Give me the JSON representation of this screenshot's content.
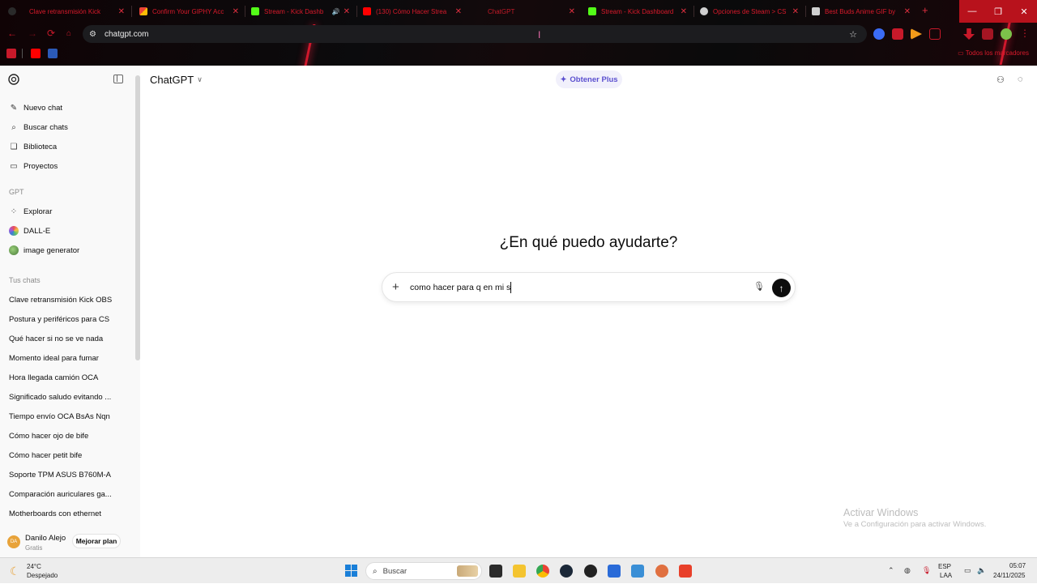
{
  "browser": {
    "tabs": [
      {
        "label": "Clave retransmisión Kick",
        "icon": "chatgpt-icon",
        "has_speaker": false
      },
      {
        "label": "Confirm Your GIPHY Acc",
        "icon": "gmail-icon",
        "has_speaker": false
      },
      {
        "label": "Stream - Kick Dashboard",
        "icon": "kick-icon",
        "has_speaker": false
      },
      {
        "label": "Stream - Kick Dashb",
        "icon": "kick-icon",
        "has_speaker": true
      },
      {
        "label": "(130) Cómo Hacer Strea",
        "icon": "youtube-icon",
        "has_speaker": false
      },
      {
        "label": "ChatGPT",
        "icon": "chatgpt-icon",
        "has_speaker": false
      },
      {
        "label": "Stream - Kick Dashboard",
        "icon": "kick-icon",
        "has_speaker": false
      },
      {
        "label": "Opciones de Steam > CS",
        "icon": "steam-icon",
        "has_speaker": false
      },
      {
        "label": "Best Buds Anime GIF by",
        "icon": "page-icon",
        "has_speaker": false
      }
    ],
    "url": "chatgpt.com",
    "bookmarks_all_label": "Todos los marcadores",
    "accent": "#d91a2b"
  },
  "sidebar": {
    "nav": [
      {
        "label": "Nuevo chat",
        "icon": "new-chat-icon"
      },
      {
        "label": "Buscar chats",
        "icon": "search-icon"
      },
      {
        "label": "Biblioteca",
        "icon": "library-icon"
      },
      {
        "label": "Proyectos",
        "icon": "folder-icon"
      }
    ],
    "gpt_heading": "GPT",
    "gpts": [
      {
        "label": "Explorar",
        "icon": "grid-icon"
      },
      {
        "label": "DALL-E",
        "icon": "dalle-icon"
      },
      {
        "label": "image generator",
        "icon": "image-generator-icon"
      }
    ],
    "chats_heading": "Tus chats",
    "chats": [
      "Clave retransmisión Kick OBS",
      "Postura y periféricos para CS",
      "Qué hacer si no se ve nada",
      "Momento ideal para fumar",
      "Hora llegada camión OCA",
      "Significado saludo evitando ...",
      "Tiempo envío OCA BsAs Nqn",
      "Cómo hacer ojo de bife",
      "Cómo hacer petit bife",
      "Soporte TPM ASUS B760M-A",
      "Comparación auriculares ga...",
      "Motherboards con ethernet"
    ],
    "user": {
      "initials": "DA",
      "name": "Danilo Alejo",
      "plan": "Gratis",
      "upgrade_label": "Mejorar plan"
    }
  },
  "main": {
    "model": "ChatGPT",
    "plus_label": "Obtener Plus",
    "greeting": "¿En qué puedo ayudarte?",
    "input_value": "como hacer para q en mi s"
  },
  "watermark": {
    "line1": "Activar Windows",
    "line2": "Ve a Configuración para activar Windows."
  },
  "taskbar": {
    "temp": "24°C",
    "weather": "Despejado",
    "search_label": "Buscar",
    "lang1": "ESP",
    "lang2": "LAA",
    "time": "05:07",
    "date": "24/11/2025"
  }
}
